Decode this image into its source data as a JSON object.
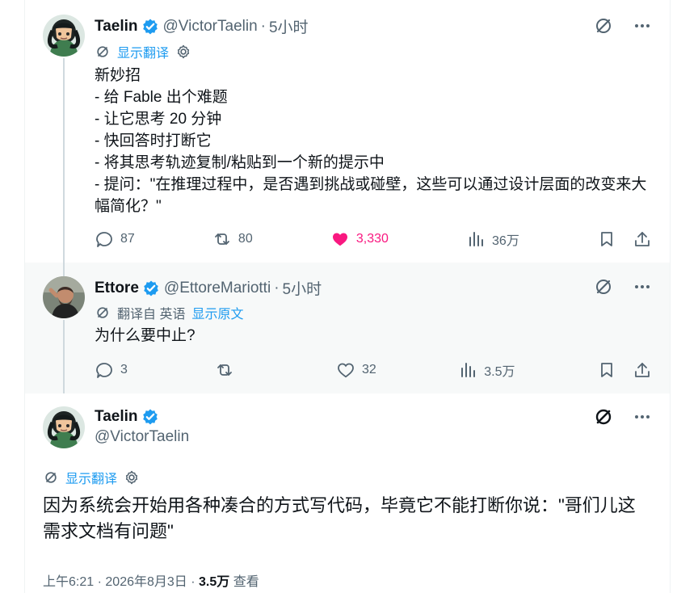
{
  "tweets": [
    {
      "author": {
        "name": "Taelin",
        "handle": "@VictorTaelin",
        "time": "5小时"
      },
      "translation": {
        "show_label": "显示翻译"
      },
      "content": "新妙招\n- 给 Fable 出个难题\n- 让它思考 20 分钟\n- 快回答时打断它\n- 将其思考轨迹复制/粘贴到一个新的提示中\n- 提问：\"在推理过程中，是否遇到挑战或碰壁，这些可以通过设计层面的改变来大幅简化？\"",
      "stats": {
        "replies": "87",
        "reposts": "80",
        "likes": "3,330",
        "views": "36万"
      }
    },
    {
      "author": {
        "name": "Ettore",
        "handle": "@EttoreMariotti",
        "time": "5小时"
      },
      "translation": {
        "from_label": "翻译自 英语",
        "show_original_label": "显示原文"
      },
      "content": "为什么要中止?",
      "stats": {
        "replies": "3",
        "reposts": "",
        "likes": "32",
        "views": "3.5万"
      }
    },
    {
      "author": {
        "name": "Taelin",
        "handle": "@VictorTaelin"
      },
      "translation": {
        "show_label": "显示翻译"
      },
      "content": "因为系统会开始用各种凑合的方式写代码，毕竟它不能打断你说：\"哥们儿这需求文档有问题\"",
      "meta": {
        "time": "上午6:21",
        "date": "2026年8月3日",
        "views_count": "3.5万",
        "views_label": "查看"
      }
    }
  ],
  "icons": {
    "translate_icon": "grok-translate-icon",
    "settings_icon": "gear-icon",
    "reply_icon": "reply-icon",
    "repost_icon": "repost-icon",
    "like_icon": "heart-icon",
    "views_icon": "analytics-icon",
    "bookmark_icon": "bookmark-icon",
    "share_icon": "share-icon",
    "more_icon": "more-icon",
    "verified_icon": "verified-badge-icon"
  },
  "colors": {
    "text_primary": "#0f1419",
    "text_secondary": "#536471",
    "accent": "#1d9bf0",
    "like": "#f91880",
    "highlight_background": "#f7f9f9",
    "border": "#eff3f4"
  }
}
